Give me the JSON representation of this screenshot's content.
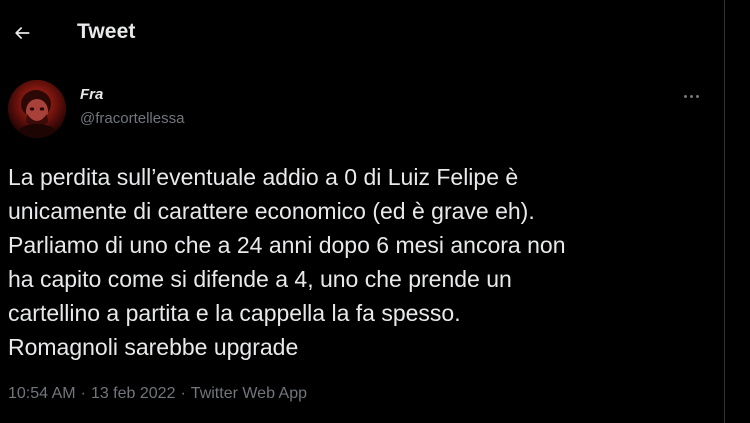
{
  "header": {
    "back_icon": "arrow-left-icon",
    "title": "Tweet"
  },
  "author": {
    "display_name": "Fra",
    "handle": "@fracortellessa",
    "avatar_icon": "avatar-photo"
  },
  "more_icon": "more-horizontal-icon",
  "tweet": {
    "text": "La perdita sull’eventuale addio a 0 di Luiz Felipe è\nunicamente di carattere economico (ed è grave eh).\nParliamo di uno che a 24 anni dopo 6 mesi ancora non\nha capito come si difende a 4, uno che prende un\ncartellino a partita e la cappella la fa spesso.\nRomagnoli sarebbe upgrade"
  },
  "meta": {
    "time": "10:54 AM",
    "separator": "·",
    "date": "13 feb 2022",
    "source": "Twitter Web App"
  },
  "colors": {
    "background": "#000000",
    "text_primary": "#e7e9ea",
    "text_secondary": "#71767b",
    "divider": "#2f3336"
  }
}
